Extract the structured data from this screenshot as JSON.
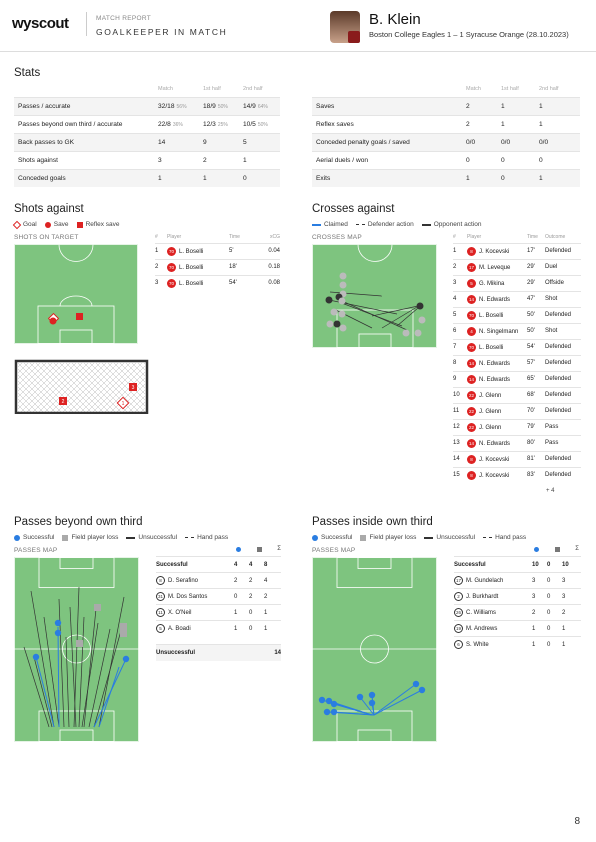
{
  "header": {
    "logo": "wyscout",
    "kicker": "MATCH REPORT",
    "title": "GOALKEEPER IN MATCH",
    "player": "B. Klein",
    "match": "Boston College Eagles 1 – 1 Syracuse Orange (28.10.2023)"
  },
  "stats": {
    "title": "Stats",
    "cols": [
      "Match",
      "1st half",
      "2nd half"
    ],
    "left": [
      {
        "label": "Passes / accurate",
        "m": "32/18",
        "mp": "56%",
        "h1": "18/9",
        "h1p": "50%",
        "h2": "14/9",
        "h2p": "64%"
      },
      {
        "label": "Passes beyond own third / accurate",
        "m": "22/8",
        "mp": "36%",
        "h1": "12/3",
        "h1p": "25%",
        "h2": "10/5",
        "h2p": "50%"
      },
      {
        "label": "Back passes to GK",
        "m": "14",
        "mp": "",
        "h1": "9",
        "h1p": "",
        "h2": "5",
        "h2p": ""
      },
      {
        "label": "Shots against",
        "m": "3",
        "mp": "",
        "h1": "2",
        "h1p": "",
        "h2": "1",
        "h2p": ""
      },
      {
        "label": "Conceded goals",
        "m": "1",
        "mp": "",
        "h1": "1",
        "h1p": "",
        "h2": "0",
        "h2p": ""
      }
    ],
    "right": [
      {
        "label": "Saves",
        "m": "2",
        "h1": "1",
        "h2": "1"
      },
      {
        "label": "Reflex saves",
        "m": "2",
        "h1": "1",
        "h2": "1"
      },
      {
        "label": "Conceded penalty goals / saved",
        "m": "0/0",
        "h1": "0/0",
        "h2": "0/0"
      },
      {
        "label": "Aerial duels / won",
        "m": "0",
        "h1": "0",
        "h2": "0"
      },
      {
        "label": "Exits",
        "m": "1",
        "h1": "0",
        "h2": "1"
      }
    ]
  },
  "shots": {
    "title": "Shots against",
    "legend": [
      "Goal",
      "Save",
      "Reflex save"
    ],
    "map_label": "SHOTS ON TARGET",
    "cols": [
      "#",
      "Player",
      "Time",
      "xCG"
    ],
    "rows": [
      {
        "n": "1",
        "num": "70",
        "player": "L. Boselli",
        "time": "5'",
        "xcg": "0.04"
      },
      {
        "n": "2",
        "num": "70",
        "player": "L. Boselli",
        "time": "18'",
        "xcg": "0.18"
      },
      {
        "n": "3",
        "num": "70",
        "player": "L. Boselli",
        "time": "54'",
        "xcg": "0.08"
      }
    ],
    "goal_marks": [
      "2",
      "3",
      "1"
    ]
  },
  "crosses": {
    "title": "Crosses against",
    "legend": [
      "Claimed",
      "Defender action",
      "Opponent action"
    ],
    "map_label": "CROSSES MAP",
    "cols": [
      "#",
      "Player",
      "Time",
      "Outcome"
    ],
    "rows": [
      {
        "n": "1",
        "num": "8",
        "player": "J. Kocevski",
        "time": "17'",
        "outcome": "Defended"
      },
      {
        "n": "2",
        "num": "17",
        "player": "M. Leveque",
        "time": "29'",
        "outcome": "Duel"
      },
      {
        "n": "3",
        "num": "5",
        "player": "G. Mikina",
        "time": "29'",
        "outcome": "Offside"
      },
      {
        "n": "4",
        "num": "14",
        "player": "N. Edwards",
        "time": "47'",
        "outcome": "Shot"
      },
      {
        "n": "5",
        "num": "70",
        "player": "L. Boselli",
        "time": "50'",
        "outcome": "Defended"
      },
      {
        "n": "6",
        "num": "4",
        "player": "N. Singelmann",
        "time": "50'",
        "outcome": "Shot"
      },
      {
        "n": "7",
        "num": "70",
        "player": "L. Boselli",
        "time": "54'",
        "outcome": "Defended"
      },
      {
        "n": "8",
        "num": "14",
        "player": "N. Edwards",
        "time": "57'",
        "outcome": "Defended"
      },
      {
        "n": "9",
        "num": "14",
        "player": "N. Edwards",
        "time": "65'",
        "outcome": "Defended"
      },
      {
        "n": "10",
        "num": "22",
        "player": "J. Glenn",
        "time": "68'",
        "outcome": "Defended"
      },
      {
        "n": "11",
        "num": "22",
        "player": "J. Glenn",
        "time": "70'",
        "outcome": "Defended"
      },
      {
        "n": "12",
        "num": "22",
        "player": "J. Glenn",
        "time": "79'",
        "outcome": "Pass"
      },
      {
        "n": "13",
        "num": "14",
        "player": "N. Edwards",
        "time": "80'",
        "outcome": "Pass"
      },
      {
        "n": "14",
        "num": "8",
        "player": "J. Kocevski",
        "time": "81'",
        "outcome": "Defended"
      },
      {
        "n": "15",
        "num": "8",
        "player": "J. Kocevski",
        "time": "83'",
        "outcome": "Defended"
      }
    ],
    "more": "+ 4"
  },
  "passes_beyond": {
    "title": "Passes beyond own third",
    "legend": [
      "Successful",
      "Field player loss",
      "Unsuccessful",
      "Hand pass"
    ],
    "map_label": "PASSES MAP",
    "sigma": "Σ",
    "summary_label": "Successful",
    "summary": [
      "4",
      "4",
      "8"
    ],
    "rows": [
      {
        "num": "8",
        "player": "D. Serafino",
        "a": "2",
        "b": "2",
        "t": "4"
      },
      {
        "num": "31",
        "player": "M. Dos Santos",
        "a": "0",
        "b": "2",
        "t": "2"
      },
      {
        "num": "11",
        "player": "X. O'Neil",
        "a": "1",
        "b": "0",
        "t": "1"
      },
      {
        "num": "5",
        "player": "A. Boadi",
        "a": "1",
        "b": "0",
        "t": "1"
      }
    ],
    "unsuccessful_label": "Unsuccessful",
    "unsuccessful": "14"
  },
  "passes_inside": {
    "title": "Passes inside own third",
    "legend": [
      "Successful",
      "Field player loss",
      "Unsuccessful",
      "Hand pass"
    ],
    "map_label": "PASSES MAP",
    "sigma": "Σ",
    "summary_label": "Successful",
    "summary": [
      "10",
      "0",
      "10"
    ],
    "rows": [
      {
        "num": "17",
        "player": "M. Gundelach",
        "a": "3",
        "b": "0",
        "t": "3"
      },
      {
        "num": "2",
        "player": "J. Burkhardt",
        "a": "3",
        "b": "0",
        "t": "3"
      },
      {
        "num": "26",
        "player": "C. Williams",
        "a": "2",
        "b": "0",
        "t": "2"
      },
      {
        "num": "19",
        "player": "M. Andrews",
        "a": "1",
        "b": "0",
        "t": "1"
      },
      {
        "num": "6",
        "player": "S. White",
        "a": "1",
        "b": "0",
        "t": "1"
      }
    ]
  },
  "page_number": "8"
}
